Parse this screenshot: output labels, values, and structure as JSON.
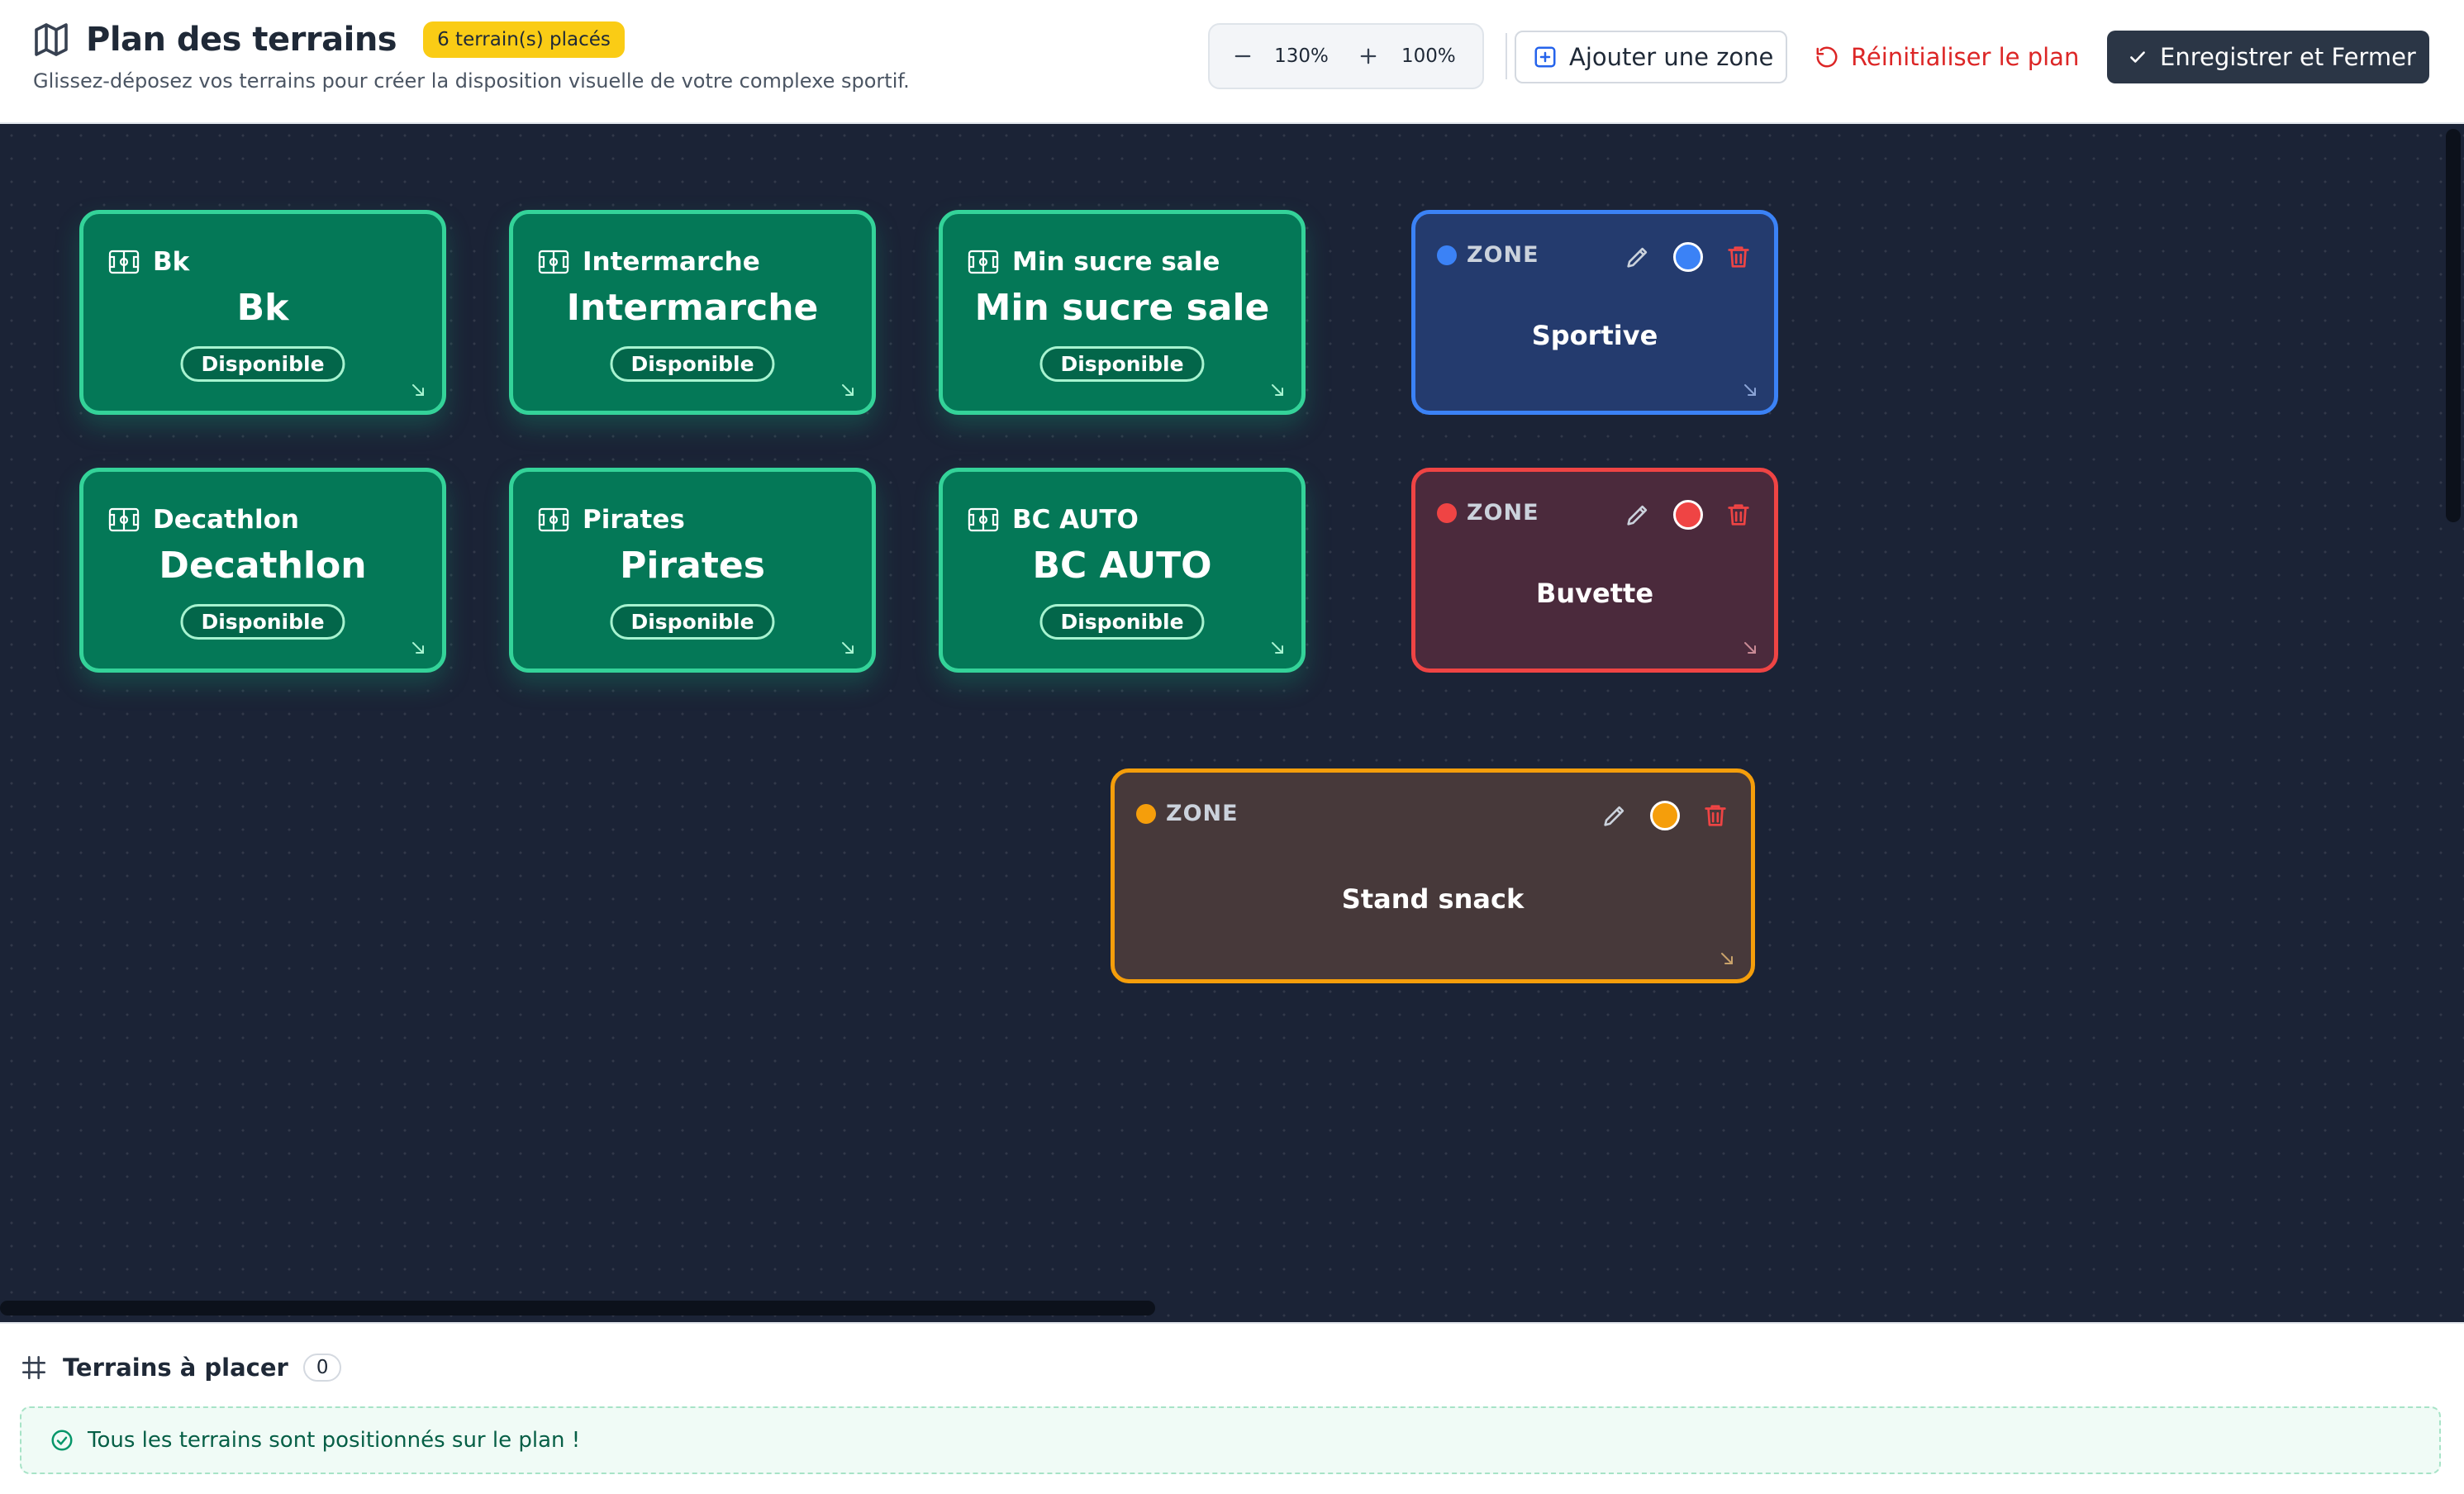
{
  "header": {
    "title": "Plan des terrains",
    "badge": "6 terrain(s) placés",
    "subtitle": "Glissez-déposez vos terrains pour créer la disposition visuelle de votre complexe sportif.",
    "zoom_level": "130%",
    "zoom_reset_label": "100%",
    "add_zone_label": "Ajouter une zone",
    "reset_plan_label": "Réinitialiser le plan",
    "save_close_label": "Enregistrer et Fermer"
  },
  "courts": [
    {
      "small_name": "Bk",
      "big_name": "Bk",
      "status": "Disponible"
    },
    {
      "small_name": "Intermarche",
      "big_name": "Intermarche",
      "status": "Disponible"
    },
    {
      "small_name": "Min sucre sale",
      "big_name": "Min sucre sale",
      "status": "Disponible"
    },
    {
      "small_name": "Decathlon",
      "big_name": "Decathlon",
      "status": "Disponible"
    },
    {
      "small_name": "Pirates",
      "big_name": "Pirates",
      "status": "Disponible"
    },
    {
      "small_name": "BC AUTO",
      "big_name": "BC AUTO",
      "status": "Disponible"
    }
  ],
  "zones": [
    {
      "label": "ZONE",
      "name": "Sportive",
      "color": "#3b82f6"
    },
    {
      "label": "ZONE",
      "name": "Buvette",
      "color": "#ef4444"
    },
    {
      "label": "ZONE",
      "name": "Stand snack",
      "color": "#f59e0b"
    }
  ],
  "bottom": {
    "title": "Terrains à placer",
    "count": "0",
    "message": "Tous les terrains sont positionnés sur le plan !"
  },
  "colors": {
    "court_bg": "#047857",
    "court_border": "#34d399",
    "canvas_bg": "#1b2336",
    "badge": "#facc15",
    "danger": "#dc2626",
    "primary_dark": "#2b3646"
  }
}
